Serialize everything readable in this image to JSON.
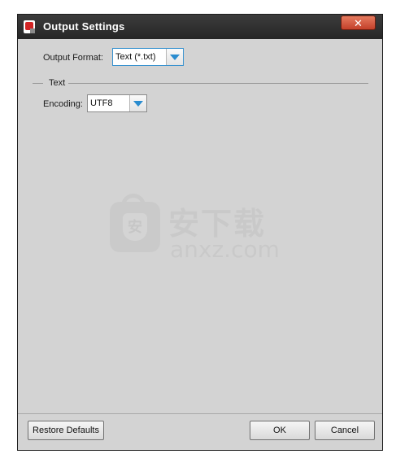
{
  "window": {
    "title": "Output Settings",
    "close_label": "✕"
  },
  "output_format": {
    "label": "Output Format:",
    "selected": "Text (*.txt)"
  },
  "text_group": {
    "title": "Text",
    "encoding_label": "Encoding:",
    "encoding_selected": "UTF8"
  },
  "watermark": {
    "cn_text": "安下载",
    "en_text": "anxz.com",
    "badge_text": "安"
  },
  "footer": {
    "restore_label": "Restore Defaults",
    "ok_label": "OK",
    "cancel_label": "Cancel"
  },
  "colors": {
    "titlebar": "#2e2e2e",
    "dialog_bg": "#d3d3d3",
    "close_button": "#d0553b",
    "dropdown_arrow": "#2a8ccf",
    "focus_border": "#3a93cf"
  }
}
